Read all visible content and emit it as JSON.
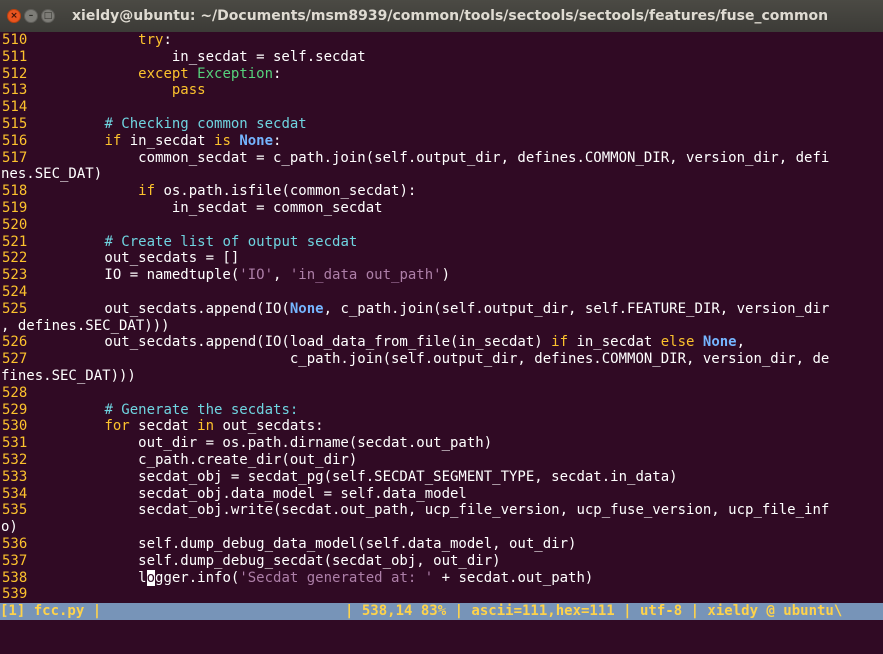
{
  "window": {
    "title": "xieldy@ubuntu: ~/Documents/msm8939/common/tools/sectools/sectools/features/fuse_common",
    "buttons": {
      "close": "×",
      "minimize": "–",
      "maximize": "□"
    }
  },
  "editor": {
    "cursor": {
      "line": "538",
      "column": 14
    },
    "lines": [
      {
        "num": "510",
        "segments": [
          {
            "t": "            "
          },
          {
            "t": "try",
            "c": "kw"
          },
          {
            "t": ":"
          }
        ]
      },
      {
        "num": "511",
        "segments": [
          {
            "t": "                in_secdat = self.secdat"
          }
        ]
      },
      {
        "num": "512",
        "segments": [
          {
            "t": "            "
          },
          {
            "t": "except",
            "c": "kw"
          },
          {
            "t": " "
          },
          {
            "t": "Exception",
            "c": "bi"
          },
          {
            "t": ":"
          }
        ]
      },
      {
        "num": "513",
        "segments": [
          {
            "t": "                "
          },
          {
            "t": "pass",
            "c": "kw"
          }
        ]
      },
      {
        "num": "514",
        "segments": []
      },
      {
        "num": "515",
        "segments": [
          {
            "t": "        "
          },
          {
            "t": "# Checking common secdat",
            "c": "cm"
          }
        ]
      },
      {
        "num": "516",
        "segments": [
          {
            "t": "        "
          },
          {
            "t": "if",
            "c": "kw"
          },
          {
            "t": " in_secdat "
          },
          {
            "t": "is",
            "c": "kw"
          },
          {
            "t": " "
          },
          {
            "t": "None",
            "c": "ct"
          },
          {
            "t": ":"
          }
        ]
      },
      {
        "num": "517",
        "segments": [
          {
            "t": "            common_secdat = c_path.join(self.output_dir, defines.COMMON_DIR, version_dir, defi"
          }
        ]
      },
      {
        "num": "",
        "segments": [
          {
            "t": "nes.SEC_DAT)"
          }
        ]
      },
      {
        "num": "518",
        "segments": [
          {
            "t": "            "
          },
          {
            "t": "if",
            "c": "kw"
          },
          {
            "t": " os.path.isfile(common_secdat):"
          }
        ]
      },
      {
        "num": "519",
        "segments": [
          {
            "t": "                in_secdat = common_secdat"
          }
        ]
      },
      {
        "num": "520",
        "segments": []
      },
      {
        "num": "521",
        "segments": [
          {
            "t": "        "
          },
          {
            "t": "# Create list of output secdat",
            "c": "cm"
          }
        ]
      },
      {
        "num": "522",
        "segments": [
          {
            "t": "        out_secdats = []"
          }
        ]
      },
      {
        "num": "523",
        "segments": [
          {
            "t": "        IO = namedtuple("
          },
          {
            "t": "'IO'",
            "c": "st"
          },
          {
            "t": ", "
          },
          {
            "t": "'in_data out_path'",
            "c": "st"
          },
          {
            "t": ")"
          }
        ]
      },
      {
        "num": "524",
        "segments": []
      },
      {
        "num": "525",
        "segments": [
          {
            "t": "        out_secdats.append(IO("
          },
          {
            "t": "None",
            "c": "ct"
          },
          {
            "t": ", c_path.join(self.output_dir, self.FEATURE_DIR, version_dir"
          }
        ]
      },
      {
        "num": "",
        "segments": [
          {
            "t": ", defines.SEC_DAT)))"
          }
        ]
      },
      {
        "num": "526",
        "segments": [
          {
            "t": "        out_secdats.append(IO(load_data_from_file(in_secdat) "
          },
          {
            "t": "if",
            "c": "kw"
          },
          {
            "t": " in_secdat "
          },
          {
            "t": "else",
            "c": "kw"
          },
          {
            "t": " "
          },
          {
            "t": "None",
            "c": "ct"
          },
          {
            "t": ","
          }
        ]
      },
      {
        "num": "527",
        "segments": [
          {
            "t": "                              c_path.join(self.output_dir, defines.COMMON_DIR, version_dir, de"
          }
        ]
      },
      {
        "num": "",
        "segments": [
          {
            "t": "fines.SEC_DAT)))"
          }
        ]
      },
      {
        "num": "528",
        "segments": []
      },
      {
        "num": "529",
        "segments": [
          {
            "t": "        "
          },
          {
            "t": "# Generate the secdats:",
            "c": "cm"
          }
        ]
      },
      {
        "num": "530",
        "segments": [
          {
            "t": "        "
          },
          {
            "t": "for",
            "c": "kw"
          },
          {
            "t": " secdat "
          },
          {
            "t": "in",
            "c": "kw"
          },
          {
            "t": " out_secdats:"
          }
        ]
      },
      {
        "num": "531",
        "segments": [
          {
            "t": "            out_dir = os.path.dirname(secdat.out_path)"
          }
        ]
      },
      {
        "num": "532",
        "segments": [
          {
            "t": "            c_path.create_dir(out_dir)"
          }
        ]
      },
      {
        "num": "533",
        "segments": [
          {
            "t": "            secdat_obj = secdat_pg(self.SECDAT_SEGMENT_TYPE, secdat.in_data)"
          }
        ]
      },
      {
        "num": "534",
        "segments": [
          {
            "t": "            secdat_obj.data_model = self.data_model"
          }
        ]
      },
      {
        "num": "535",
        "segments": [
          {
            "t": "            secdat_obj.write(secdat.out_path, ucp_file_version, ucp_fuse_version, ucp_file_inf"
          }
        ]
      },
      {
        "num": "",
        "segments": [
          {
            "t": "o)"
          }
        ]
      },
      {
        "num": "536",
        "segments": [
          {
            "t": "            self.dump_debug_data_model(self.data_model, out_dir)"
          }
        ]
      },
      {
        "num": "537",
        "segments": [
          {
            "t": "            self.dump_debug_secdat(secdat_obj, out_dir)"
          }
        ]
      },
      {
        "num": "538",
        "segments": [
          {
            "t": "            l"
          },
          {
            "t": "o",
            "c": "cur"
          },
          {
            "t": "gger.info("
          },
          {
            "t": "'Secdat generated at: '",
            "c": "st"
          },
          {
            "t": " + secdat.out_path)"
          }
        ]
      },
      {
        "num": "539",
        "segments": []
      }
    ]
  },
  "statusbar": {
    "left": "[1] fcc.py |",
    "right": "| 538,14 83% | ascii=111,hex=111 | utf-8 | xieldy @ ubuntu\\"
  }
}
